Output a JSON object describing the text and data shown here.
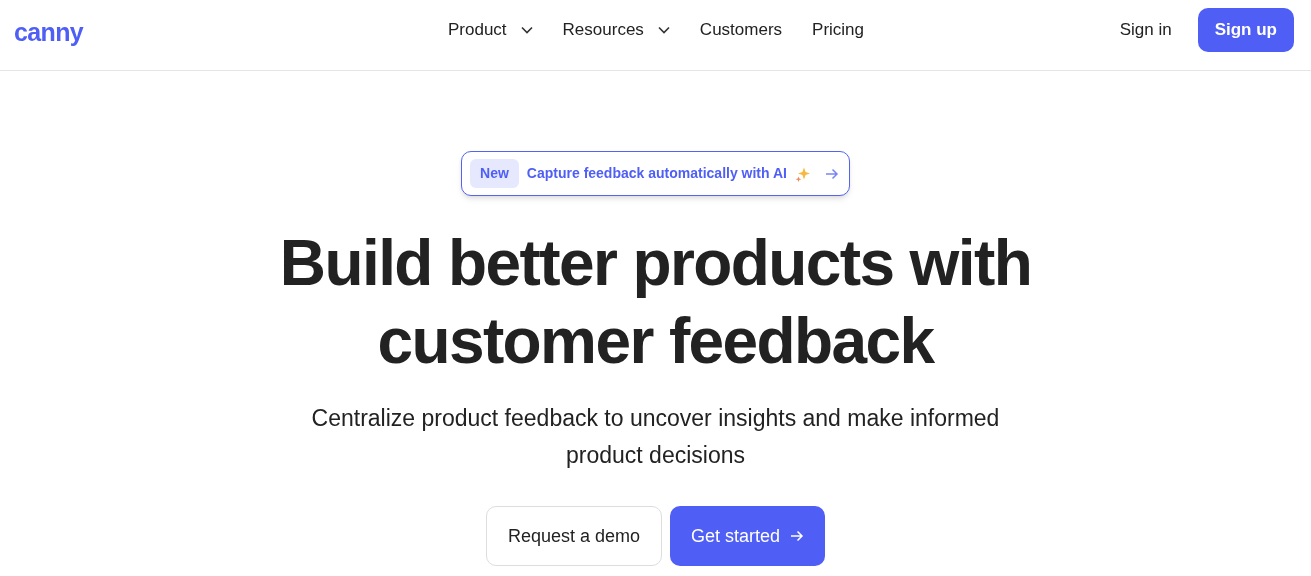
{
  "logo": "canny",
  "nav": [
    {
      "label": "Product",
      "kind": "dropdown"
    },
    {
      "label": "Resources",
      "kind": "dropdown"
    },
    {
      "label": "Customers",
      "kind": "link"
    },
    {
      "label": "Pricing",
      "kind": "link"
    }
  ],
  "sign_in": "Sign in",
  "sign_up": "Sign up",
  "announcement": {
    "badge": "New",
    "text": "Capture feedback automatically with AI"
  },
  "headline": "Build better products with customer feedback",
  "subtitle": "Centralize product feedback to uncover insights and make informed product decisions",
  "buttons": [
    {
      "label": "Request a demo",
      "kind": "secondary"
    },
    {
      "label": "Get started",
      "kind": "primary"
    }
  ]
}
